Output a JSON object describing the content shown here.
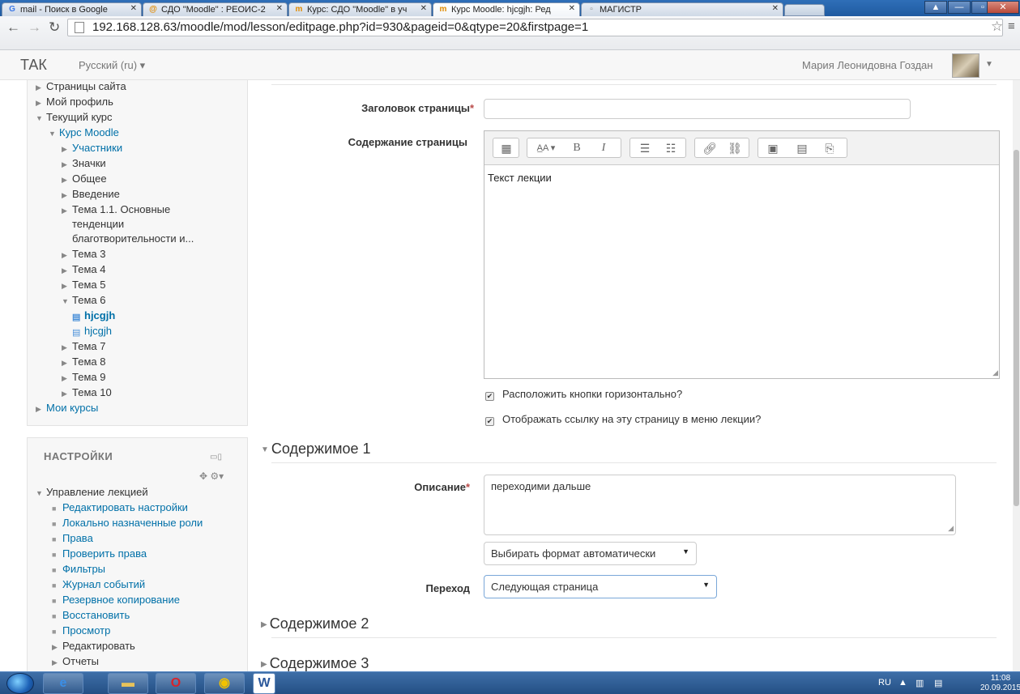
{
  "browser": {
    "tabs": [
      {
        "icon": "G",
        "label": "mail - Поиск в Google"
      },
      {
        "icon": "@",
        "label": "СДО \"Moodle\" : РЕОИС-2"
      },
      {
        "icon": "m",
        "label": "Курс: СДО \"Moodle\" в уч"
      },
      {
        "icon": "m",
        "label": "Курс Moodle: hjcgjh: Ред"
      },
      {
        "icon": "▫",
        "label": "МАГИСТР"
      }
    ],
    "url": "192.168.128.63/moodle/mod/lesson/editpage.php?id=930&pageid=0&qtype=20&firstpage=1"
  },
  "topbar": {
    "brand": "ТАК",
    "language": "Русский (ru) ▾",
    "user_name": "Мария Леонидовна Гоздан"
  },
  "navigation": {
    "items": [
      {
        "label": "Страницы сайта"
      },
      {
        "label": "Мой профиль"
      },
      {
        "label": "Текущий курс"
      },
      {
        "label": "Курс Moodle"
      },
      {
        "label": "Участники"
      },
      {
        "label": "Значки"
      },
      {
        "label": "Общее"
      },
      {
        "label": "Введение"
      },
      {
        "label": "Тема 1.1. Основные"
      },
      {
        "label": "тенденции"
      },
      {
        "label": "благотворительности и..."
      },
      {
        "label": "Тема 3"
      },
      {
        "label": "Тема 4"
      },
      {
        "label": "Тема 5"
      },
      {
        "label": "Тема 6"
      },
      {
        "label": "hjcgjh"
      },
      {
        "label": "hjcgjh"
      },
      {
        "label": "Тема 7"
      },
      {
        "label": "Тема 8"
      },
      {
        "label": "Тема 9"
      },
      {
        "label": "Тема 10"
      },
      {
        "label": "Мои курсы"
      }
    ]
  },
  "settings": {
    "title": "НАСТРОЙКИ",
    "group": "Управление лекцией",
    "items": [
      {
        "label": "Редактировать настройки"
      },
      {
        "label": "Локально назначенные роли"
      },
      {
        "label": "Права"
      },
      {
        "label": "Проверить права"
      },
      {
        "label": "Фильтры"
      },
      {
        "label": "Журнал событий"
      },
      {
        "label": "Резервное копирование"
      },
      {
        "label": "Восстановить"
      },
      {
        "label": "Просмотр"
      },
      {
        "label": "Редактировать"
      },
      {
        "label": "Отчеты"
      }
    ]
  },
  "form": {
    "page_title_label": "Заголовок страницы",
    "page_title_value": "",
    "page_content_label": "Содержание страницы",
    "editor_text": "Текст лекции",
    "chk_horizontal": "Расположить кнопки горизонтально?",
    "chk_show_link": "Отображать ссылку на эту страницу в меню лекции?",
    "content1_title": "Содержимое 1",
    "description_label": "Описание",
    "description_value": "переходими дальше",
    "format_value": "Выбирать формат автоматически",
    "jump_label": "Переход",
    "jump_value": "Следующая страница",
    "content2_title": "Содержимое 2",
    "content3_title": "Содержимое 3",
    "required_mark": "*"
  },
  "taskbar": {
    "lang": "RU",
    "time": "11:08",
    "date": "20.09.2015"
  }
}
